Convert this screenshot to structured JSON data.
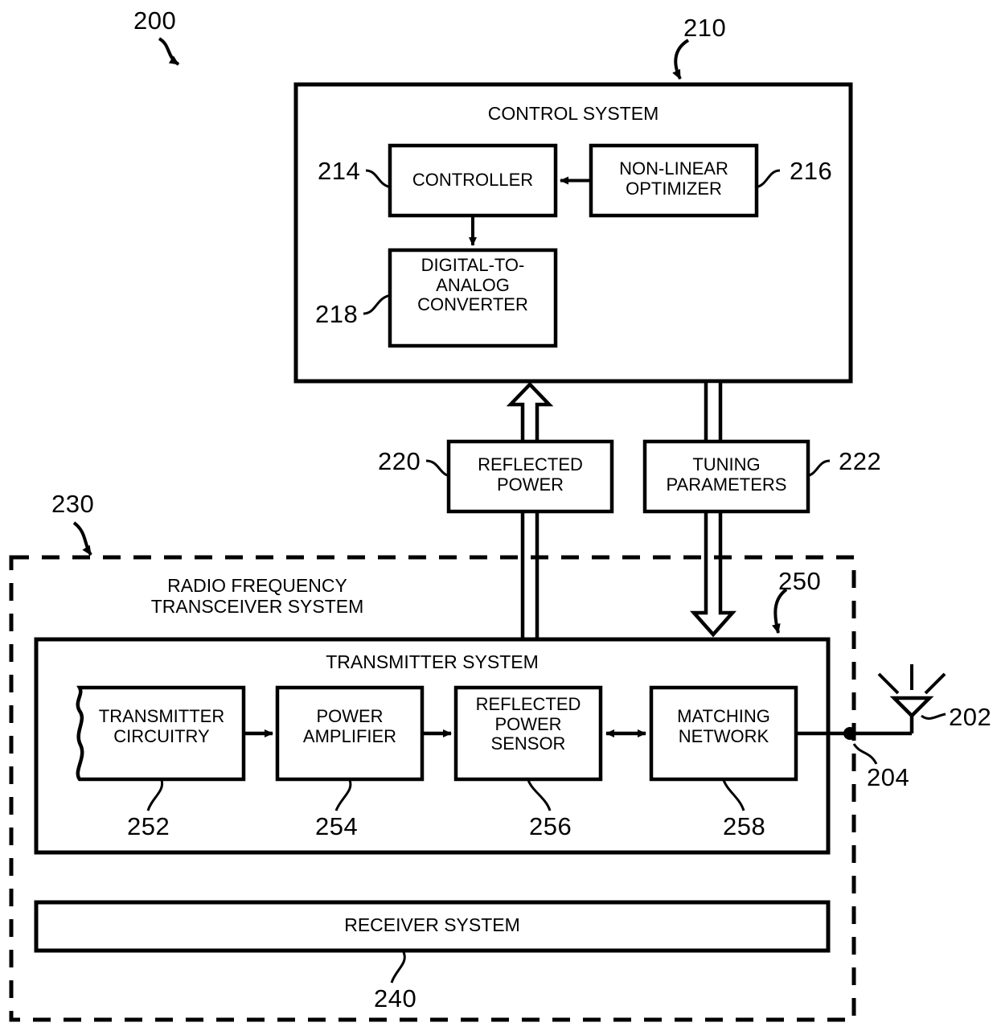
{
  "figure": {
    "id": "200",
    "type": "patent-block-diagram",
    "title_ref": "200"
  },
  "control_system": {
    "ref": "210",
    "title": "CONTROL SYSTEM",
    "blocks": [
      {
        "ref": "214",
        "label": "CONTROLLER"
      },
      {
        "ref": "216",
        "label": "NON-LINEAR\nOPTIMIZER"
      },
      {
        "ref": "218",
        "label": "DIGITAL-TO-\nANALOG\nCONVERTER"
      }
    ]
  },
  "signals": [
    {
      "ref": "220",
      "label": "REFLECTED\nPOWER",
      "direction": "up"
    },
    {
      "ref": "222",
      "label": "TUNING\nPARAMETERS",
      "direction": "down"
    }
  ],
  "rf_transceiver_system": {
    "ref": "230",
    "title": "RADIO FREQUENCY\nTRANSCEIVER SYSTEM",
    "transmitter_system": {
      "ref": "250",
      "title": "TRANSMITTER SYSTEM",
      "blocks": [
        {
          "ref": "252",
          "label": "TRANSMITTER\nCIRCUITRY"
        },
        {
          "ref": "254",
          "label": "POWER\nAMPLIFIER"
        },
        {
          "ref": "256",
          "label": "REFLECTED\nPOWER\nSENSOR"
        },
        {
          "ref": "258",
          "label": "MATCHING\nNETWORK"
        }
      ]
    },
    "receiver_system": {
      "ref": "240",
      "label": "RECEIVER SYSTEM"
    }
  },
  "antenna": {
    "ref": "202",
    "name": "antenna"
  },
  "antenna_node": {
    "ref": "204",
    "name": "antenna-feed-node"
  },
  "colors": {
    "line": "#000000",
    "background": "#ffffff"
  }
}
